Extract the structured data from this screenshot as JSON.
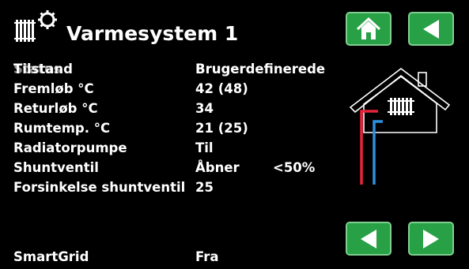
{
  "header": {
    "title": "Varmesystem 1",
    "icon": "radiator-settings-icon"
  },
  "nav": {
    "home_icon": "home-icon",
    "back_icon": "back-arrow-icon",
    "prev_icon": "left-arrow-icon",
    "next_icon": "right-arrow-icon"
  },
  "status": {
    "ghost_label": "Status",
    "ghost_value": "Bruger"
  },
  "rows": [
    {
      "label": "Tilstand",
      "value": "Brugerdefinerede"
    },
    {
      "label": "Fremløb °C",
      "value": "42 (48)"
    },
    {
      "label": "Returløb °C",
      "value": "34"
    },
    {
      "label": "Rumtemp. °C",
      "value": "21 (25)"
    },
    {
      "label": "Radiatorpumpe",
      "value": "Til"
    },
    {
      "label": "Shuntventil",
      "value": "Åbner",
      "extra": "<50%"
    },
    {
      "label": "Forsinkelse shuntventil",
      "value": "25"
    }
  ],
  "smartgrid": {
    "label": "SmartGrid",
    "value": "Fra"
  },
  "colors": {
    "button": "#27a046",
    "pipe_supply": "#e8233a",
    "pipe_return": "#2f8fe0"
  }
}
